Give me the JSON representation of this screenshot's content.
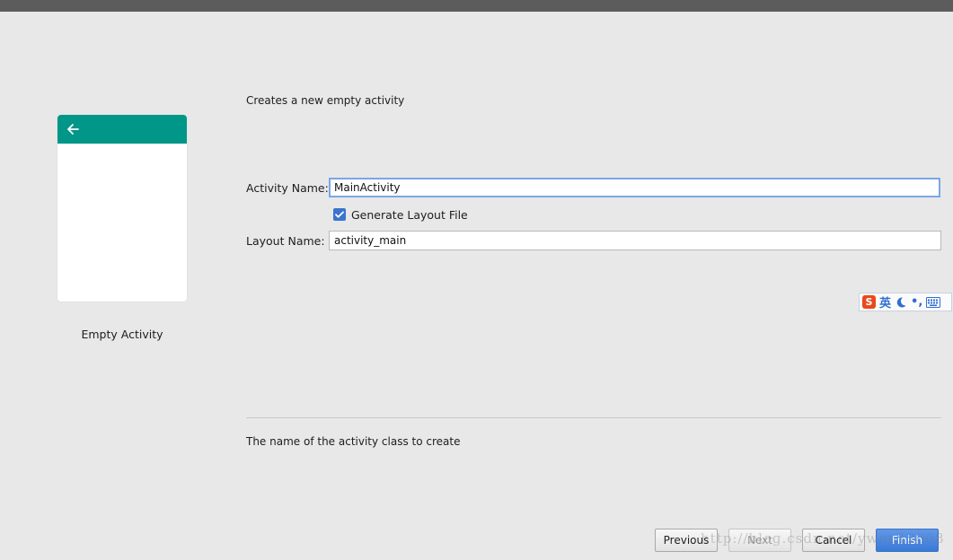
{
  "preview": {
    "template_name": "Empty Activity",
    "toolbar_color": "#009688",
    "back_icon": "arrow-left-icon"
  },
  "description": "Creates a new empty activity",
  "form": {
    "activity_name_label": "Activity Name:",
    "activity_name_value": "MainActivity",
    "generate_layout_label": "Generate Layout File",
    "generate_layout_checked": true,
    "layout_name_label": "Layout Name:",
    "layout_name_value": "activity_main"
  },
  "ime": {
    "logo": "S",
    "language": "英",
    "punctuation": "•,"
  },
  "help_text": "The name of the activity class to create",
  "buttons": {
    "previous": "Previous",
    "next": "Next",
    "cancel": "Cancel",
    "finish": "Finish"
  },
  "watermark": "http://blog.csdn.net/ywen12008",
  "colors": {
    "accent": "#3b73cf",
    "finish": "#3a79d6"
  }
}
